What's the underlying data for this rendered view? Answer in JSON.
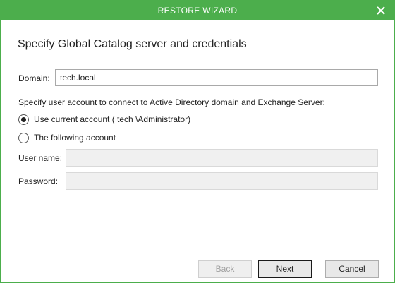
{
  "window": {
    "title": "RESTORE WIZARD",
    "accent_color": "#4cae4c"
  },
  "page": {
    "heading": "Specify Global Catalog server and credentials",
    "domain_label": "Domain:",
    "domain_value": "tech.local",
    "account_prompt": "Specify user account to connect to Active Directory domain and Exchange Server:",
    "options": [
      {
        "label": "Use current account ( tech \\Administrator)",
        "selected": true
      },
      {
        "label": "The following account",
        "selected": false
      }
    ],
    "username_label": "User name:",
    "username_value": "",
    "password_label": "Password:",
    "password_value": ""
  },
  "footer": {
    "back_label": "Back",
    "next_label": "Next",
    "cancel_label": "Cancel"
  },
  "icons": {
    "close": "close-icon"
  }
}
